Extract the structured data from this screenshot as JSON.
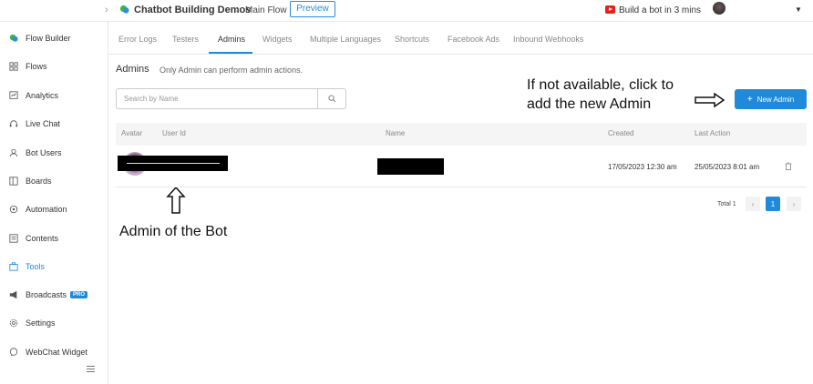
{
  "header": {
    "bot_name": "Chatbot Building Demos",
    "flow_name": "Main Flow",
    "preview_label": "Preview",
    "build_bot_label": "Build a bot in 3 mins"
  },
  "sidebar": {
    "items": [
      {
        "label": "Flow Builder"
      },
      {
        "label": "Flows"
      },
      {
        "label": "Analytics"
      },
      {
        "label": "Live Chat"
      },
      {
        "label": "Bot Users"
      },
      {
        "label": "Boards"
      },
      {
        "label": "Automation"
      },
      {
        "label": "Contents"
      },
      {
        "label": "Tools"
      },
      {
        "label": "Broadcasts",
        "badge": "PRO"
      },
      {
        "label": "Settings"
      },
      {
        "label": "WebChat Widget"
      }
    ],
    "active_item": "Tools"
  },
  "tabs": [
    {
      "label": "Error Logs"
    },
    {
      "label": "Testers"
    },
    {
      "label": "Admins"
    },
    {
      "label": "Widgets"
    },
    {
      "label": "Multiple Languages"
    },
    {
      "label": "Shortcuts"
    },
    {
      "label": "Facebook Ads"
    },
    {
      "label": "Inbound Webhooks"
    }
  ],
  "active_tab": "Admins",
  "admins": {
    "title": "Admins",
    "note": "Only Admin can perform admin actions.",
    "search_placeholder": "Search by Name",
    "new_admin_label": "New Admin"
  },
  "table": {
    "columns": [
      "Avatar",
      "User Id",
      "Name",
      "Created",
      "Last Action"
    ],
    "rows": [
      {
        "created": "17/05/2023 12:30 am",
        "last_action": "25/05/2023 8:01 am"
      }
    ]
  },
  "pagination": {
    "total_label": "Total 1",
    "current_page": "1"
  },
  "annotations": {
    "top_line1": "If not available, click to",
    "top_line2": "add the new Admin",
    "bottom": "Admin of the Bot"
  },
  "colors": {
    "accent": "#1f8ad9",
    "youtube": "#e62117"
  }
}
